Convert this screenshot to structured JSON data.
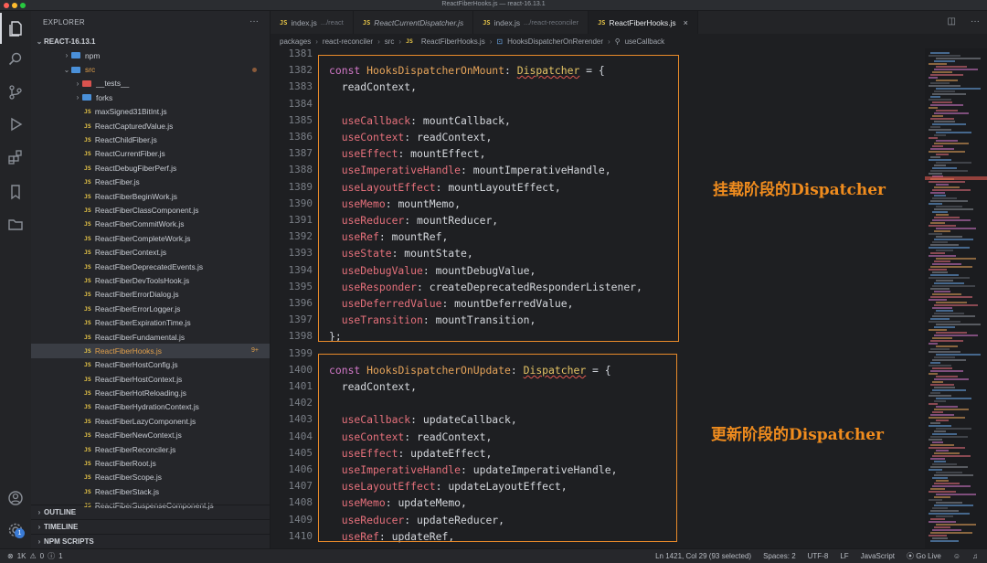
{
  "window": {
    "title": "ReactFiberHooks.js — react-16.13.1"
  },
  "activity_bar": {
    "icons": [
      "files-icon",
      "search-icon",
      "source-control-icon",
      "run-debug-icon",
      "extensions-icon",
      "bookmark-icon",
      "folder-icon",
      "account-icon",
      "settings-gear-icon"
    ],
    "settings_badge": "1"
  },
  "sidebar": {
    "header": "EXPLORER",
    "more": "···",
    "root": "REACT-16.13.1",
    "tree": [
      {
        "label": "npm",
        "kind": "folder",
        "chevron": "›",
        "indent": 0,
        "color": "#4a90d9"
      },
      {
        "label": "src",
        "kind": "folder",
        "chevron": "⌄",
        "indent": 0,
        "color": "#4a90d9",
        "highlight": true,
        "dot": true
      },
      {
        "label": "__tests__",
        "kind": "folder",
        "chevron": "›",
        "indent": 1,
        "color": "#d9534f"
      },
      {
        "label": "forks",
        "kind": "folder",
        "chevron": "›",
        "indent": 1,
        "color": "#4a90d9"
      },
      {
        "label": "maxSigned31BitInt.js",
        "kind": "js",
        "indent": 1
      },
      {
        "label": "ReactCapturedValue.js",
        "kind": "js",
        "indent": 1
      },
      {
        "label": "ReactChildFiber.js",
        "kind": "js",
        "indent": 1
      },
      {
        "label": "ReactCurrentFiber.js",
        "kind": "js",
        "indent": 1
      },
      {
        "label": "ReactDebugFiberPerf.js",
        "kind": "js",
        "indent": 1
      },
      {
        "label": "ReactFiber.js",
        "kind": "js",
        "indent": 1
      },
      {
        "label": "ReactFiberBeginWork.js",
        "kind": "js",
        "indent": 1
      },
      {
        "label": "ReactFiberClassComponent.js",
        "kind": "js",
        "indent": 1
      },
      {
        "label": "ReactFiberCommitWork.js",
        "kind": "js",
        "indent": 1
      },
      {
        "label": "ReactFiberCompleteWork.js",
        "kind": "js",
        "indent": 1
      },
      {
        "label": "ReactFiberContext.js",
        "kind": "js",
        "indent": 1
      },
      {
        "label": "ReactFiberDeprecatedEvents.js",
        "kind": "js",
        "indent": 1
      },
      {
        "label": "ReactFiberDevToolsHook.js",
        "kind": "js",
        "indent": 1
      },
      {
        "label": "ReactFiberErrorDialog.js",
        "kind": "js",
        "indent": 1
      },
      {
        "label": "ReactFiberErrorLogger.js",
        "kind": "js",
        "indent": 1
      },
      {
        "label": "ReactFiberExpirationTime.js",
        "kind": "js",
        "indent": 1
      },
      {
        "label": "ReactFiberFundamental.js",
        "kind": "js",
        "indent": 1
      },
      {
        "label": "ReactFiberHooks.js",
        "kind": "js",
        "indent": 1,
        "selected": true,
        "extra": "9+"
      },
      {
        "label": "ReactFiberHostConfig.js",
        "kind": "js",
        "indent": 1
      },
      {
        "label": "ReactFiberHostContext.js",
        "kind": "js",
        "indent": 1
      },
      {
        "label": "ReactFiberHotReloading.js",
        "kind": "js",
        "indent": 1
      },
      {
        "label": "ReactFiberHydrationContext.js",
        "kind": "js",
        "indent": 1
      },
      {
        "label": "ReactFiberLazyComponent.js",
        "kind": "js",
        "indent": 1
      },
      {
        "label": "ReactFiberNewContext.js",
        "kind": "js",
        "indent": 1
      },
      {
        "label": "ReactFiberReconciler.js",
        "kind": "js",
        "indent": 1
      },
      {
        "label": "ReactFiberRoot.js",
        "kind": "js",
        "indent": 1
      },
      {
        "label": "ReactFiberScope.js",
        "kind": "js",
        "indent": 1
      },
      {
        "label": "ReactFiberStack.js",
        "kind": "js",
        "indent": 1
      },
      {
        "label": "ReactFiberSuspenseComponent.js",
        "kind": "js",
        "indent": 1
      }
    ],
    "bottom_sections": [
      "OUTLINE",
      "TIMELINE",
      "NPM SCRIPTS"
    ]
  },
  "tabs": [
    {
      "badge": "JS",
      "label": "index.js",
      "desc": ".../react"
    },
    {
      "badge": "JS",
      "label": "ReactCurrentDispatcher.js",
      "italic": true
    },
    {
      "badge": "JS",
      "label": "index.js",
      "desc": ".../react-reconciler"
    },
    {
      "badge": "JS",
      "label": "ReactFiberHooks.js",
      "active": true,
      "close": "×"
    }
  ],
  "breadcrumb": [
    "packages",
    "react-reconciler",
    "src",
    "ReactFiberHooks.js",
    "HooksDispatcherOnRerender",
    "useCallback"
  ],
  "code_lines": [
    {
      "n": "1381",
      "tokens": []
    },
    {
      "n": "1382",
      "tokens": [
        [
          "kw",
          "const "
        ],
        [
          "ident",
          "HooksDispatcherOnMount"
        ],
        [
          "op",
          ": "
        ],
        [
          "type",
          "Dispatcher"
        ],
        [
          "op",
          " = {"
        ]
      ]
    },
    {
      "n": "1383",
      "tokens": [
        [
          "val",
          "  readContext,"
        ]
      ]
    },
    {
      "n": "1384",
      "tokens": []
    },
    {
      "n": "1385",
      "tokens": [
        [
          "prop",
          "  useCallback"
        ],
        [
          "op",
          ": "
        ],
        [
          "val",
          "mountCallback,"
        ]
      ]
    },
    {
      "n": "1386",
      "tokens": [
        [
          "prop",
          "  useContext"
        ],
        [
          "op",
          ": "
        ],
        [
          "val",
          "readContext,"
        ]
      ]
    },
    {
      "n": "1387",
      "tokens": [
        [
          "prop",
          "  useEffect"
        ],
        [
          "op",
          ": "
        ],
        [
          "val",
          "mountEffect,"
        ]
      ]
    },
    {
      "n": "1388",
      "tokens": [
        [
          "prop",
          "  useImperativeHandle"
        ],
        [
          "op",
          ": "
        ],
        [
          "val",
          "mountImperativeHandle,"
        ]
      ]
    },
    {
      "n": "1389",
      "tokens": [
        [
          "prop",
          "  useLayoutEffect"
        ],
        [
          "op",
          ": "
        ],
        [
          "val",
          "mountLayoutEffect,"
        ]
      ]
    },
    {
      "n": "1390",
      "tokens": [
        [
          "prop",
          "  useMemo"
        ],
        [
          "op",
          ": "
        ],
        [
          "val",
          "mountMemo,"
        ]
      ]
    },
    {
      "n": "1391",
      "tokens": [
        [
          "prop",
          "  useReducer"
        ],
        [
          "op",
          ": "
        ],
        [
          "val",
          "mountReducer,"
        ]
      ]
    },
    {
      "n": "1392",
      "tokens": [
        [
          "prop",
          "  useRef"
        ],
        [
          "op",
          ": "
        ],
        [
          "val",
          "mountRef,"
        ]
      ]
    },
    {
      "n": "1393",
      "tokens": [
        [
          "prop",
          "  useState"
        ],
        [
          "op",
          ": "
        ],
        [
          "val",
          "mountState,"
        ]
      ]
    },
    {
      "n": "1394",
      "tokens": [
        [
          "prop",
          "  useDebugValue"
        ],
        [
          "op",
          ": "
        ],
        [
          "val",
          "mountDebugValue,"
        ]
      ]
    },
    {
      "n": "1395",
      "tokens": [
        [
          "prop",
          "  useResponder"
        ],
        [
          "op",
          ": "
        ],
        [
          "val",
          "createDeprecatedResponderListener,"
        ]
      ]
    },
    {
      "n": "1396",
      "tokens": [
        [
          "prop",
          "  useDeferredValue"
        ],
        [
          "op",
          ": "
        ],
        [
          "val",
          "mountDeferredValue,"
        ]
      ]
    },
    {
      "n": "1397",
      "tokens": [
        [
          "prop",
          "  useTransition"
        ],
        [
          "op",
          ": "
        ],
        [
          "val",
          "mountTransition,"
        ]
      ]
    },
    {
      "n": "1398",
      "tokens": [
        [
          "op",
          "};"
        ]
      ]
    },
    {
      "n": "1399",
      "tokens": []
    },
    {
      "n": "1400",
      "tokens": [
        [
          "kw",
          "const "
        ],
        [
          "ident",
          "HooksDispatcherOnUpdate"
        ],
        [
          "op",
          ": "
        ],
        [
          "type",
          "Dispatcher"
        ],
        [
          "op",
          " = {"
        ]
      ]
    },
    {
      "n": "1401",
      "tokens": [
        [
          "val",
          "  readContext,"
        ]
      ]
    },
    {
      "n": "1402",
      "tokens": []
    },
    {
      "n": "1403",
      "tokens": [
        [
          "prop",
          "  useCallback"
        ],
        [
          "op",
          ": "
        ],
        [
          "val",
          "updateCallback,"
        ]
      ]
    },
    {
      "n": "1404",
      "tokens": [
        [
          "prop",
          "  useContext"
        ],
        [
          "op",
          ": "
        ],
        [
          "val",
          "readContext,"
        ]
      ]
    },
    {
      "n": "1405",
      "tokens": [
        [
          "prop",
          "  useEffect"
        ],
        [
          "op",
          ": "
        ],
        [
          "val",
          "updateEffect,"
        ]
      ]
    },
    {
      "n": "1406",
      "tokens": [
        [
          "prop",
          "  useImperativeHandle"
        ],
        [
          "op",
          ": "
        ],
        [
          "val",
          "updateImperativeHandle,"
        ]
      ]
    },
    {
      "n": "1407",
      "tokens": [
        [
          "prop",
          "  useLayoutEffect"
        ],
        [
          "op",
          ": "
        ],
        [
          "val",
          "updateLayoutEffect,"
        ]
      ]
    },
    {
      "n": "1408",
      "tokens": [
        [
          "prop",
          "  useMemo"
        ],
        [
          "op",
          ": "
        ],
        [
          "val",
          "updateMemo,"
        ]
      ]
    },
    {
      "n": "1409",
      "tokens": [
        [
          "prop",
          "  useReducer"
        ],
        [
          "op",
          ": "
        ],
        [
          "val",
          "updateReducer,"
        ]
      ]
    },
    {
      "n": "1410",
      "tokens": [
        [
          "prop",
          "  useRef"
        ],
        [
          "op",
          ": "
        ],
        [
          "val",
          "updateRef,"
        ]
      ]
    }
  ],
  "annotations": {
    "mount": "挂载阶段的Dispatcher",
    "update": "更新阶段的Dispatcher"
  },
  "statusbar": {
    "left": [
      "⊗",
      "1K",
      "⚠",
      "0",
      "ⓘ",
      "1"
    ],
    "right": [
      "Ln 1421, Col 29 (93 selected)",
      "Spaces: 2",
      "UTF-8",
      "LF",
      "JavaScript",
      "Go Live"
    ]
  },
  "colors": {
    "accent": "#e88a2a",
    "keyword": "#d278c8",
    "property": "#e5707b",
    "identifier": "#e6a45a"
  }
}
